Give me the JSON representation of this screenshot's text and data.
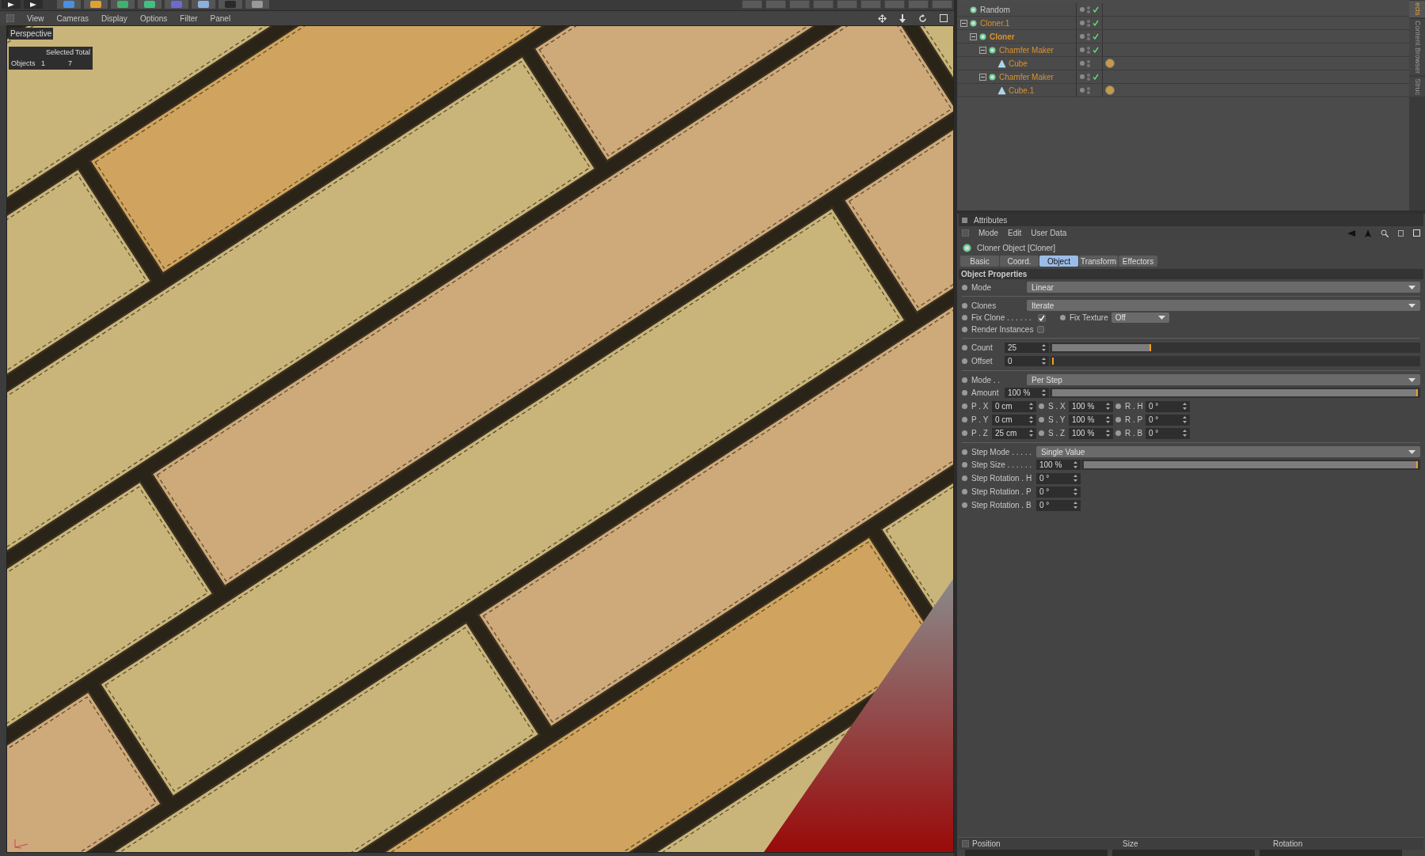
{
  "viewport": {
    "menu": [
      "View",
      "Cameras",
      "Display",
      "Options",
      "Filter",
      "Panel"
    ],
    "camera": "Perspective",
    "hud": {
      "headers": [
        "Selected",
        "Total"
      ],
      "row": {
        "label": "Objects",
        "selected": "1",
        "total": "7"
      }
    }
  },
  "object_manager": {
    "objects": [
      {
        "name": "Random",
        "active": false,
        "selected": false,
        "checked": true,
        "material": false
      },
      {
        "name": "Cloner.1",
        "active": true,
        "selected": false,
        "checked": true,
        "material": false,
        "expanded": true,
        "children": [
          {
            "name": "Cloner",
            "active": true,
            "selected": true,
            "checked": true,
            "material": false,
            "expanded": true,
            "children": [
              {
                "name": "Chamfer Maker",
                "active": true,
                "selected": false,
                "checked": true,
                "material": false,
                "expanded": true,
                "children": [
                  {
                    "name": "Cube",
                    "active": true,
                    "selected": false,
                    "checked": false,
                    "material": true
                  }
                ]
              },
              {
                "name": "Chamfer Maker",
                "active": true,
                "selected": false,
                "checked": true,
                "material": false,
                "expanded": true,
                "children": [
                  {
                    "name": "Cube.1",
                    "active": true,
                    "selected": false,
                    "checked": false,
                    "material": true
                  }
                ]
              }
            ]
          }
        ]
      }
    ],
    "side_tabs": [
      {
        "label": "ects",
        "selected": true
      },
      {
        "label": "Content Browser",
        "selected": false
      },
      {
        "label": "Struc",
        "selected": false
      }
    ]
  },
  "attributes": {
    "title": "Attributes",
    "menu": [
      "Mode",
      "Edit",
      "User Data"
    ],
    "object_title": "Cloner Object [Cloner]",
    "tabs": [
      {
        "label": "Basic",
        "selected": false
      },
      {
        "label": "Coord.",
        "selected": false
      },
      {
        "label": "Object",
        "selected": true
      },
      {
        "label": "Transform",
        "selected": false
      },
      {
        "label": "Effectors",
        "selected": false
      }
    ],
    "section": "Object Properties",
    "rows": [
      {
        "kind": "dropdown",
        "label": "Mode",
        "value": "Linear",
        "divider_before": false
      },
      {
        "kind": "dropdown",
        "label": "Clones",
        "value": "Iterate",
        "divider_before": true
      },
      {
        "kind": "check_combo",
        "label": "Fix Clone . . . . . .",
        "checked": true,
        "second_label": "Fix Texture",
        "value": "Off",
        "divider_before": false
      },
      {
        "kind": "checkbox",
        "label": "Render Instances",
        "checked": false,
        "divider_before": false
      },
      {
        "kind": "slider",
        "label": "Count",
        "value": "25",
        "level": 0.27,
        "divider_before": true
      },
      {
        "kind": "slider",
        "label": "Offset",
        "value": "0",
        "level": 0,
        "divider_before": false
      },
      {
        "kind": "dropdown",
        "label": "Mode . .",
        "value": "Per Step",
        "divider_before": true
      },
      {
        "kind": "slider",
        "label": "Amount",
        "value": "100 %",
        "level": 1,
        "divider_before": false
      },
      {
        "kind": "vector",
        "cells": [
          {
            "label": "P . X",
            "value": "0 cm"
          },
          {
            "label": "S . X",
            "value": "100 %"
          },
          {
            "label": "R . H",
            "value": "0 °"
          }
        ],
        "divider_before": false
      },
      {
        "kind": "vector",
        "cells": [
          {
            "label": "P . Y",
            "value": "0 cm"
          },
          {
            "label": "S . Y",
            "value": "100 %"
          },
          {
            "label": "R . P",
            "value": "0 °"
          }
        ],
        "divider_before": false
      },
      {
        "kind": "vector",
        "cells": [
          {
            "label": "P . Z",
            "value": "25 cm"
          },
          {
            "label": "S . Z",
            "value": "100 %"
          },
          {
            "label": "R . B",
            "value": "0 °"
          }
        ],
        "divider_before": false
      },
      {
        "kind": "dropdown",
        "label": "Step Mode . . . . .",
        "value": "Single Value",
        "divider_before": true
      },
      {
        "kind": "slider",
        "label": "Step Size . . . . . .",
        "value": "100 %",
        "level": 1,
        "divider_before": false
      },
      {
        "kind": "number",
        "label": "Step Rotation . H",
        "value": "0 °",
        "divider_before": false
      },
      {
        "kind": "number",
        "label": "Step Rotation . P",
        "value": "0 °",
        "divider_before": false
      },
      {
        "kind": "number",
        "label": "Step Rotation . B",
        "value": "0 °",
        "divider_before": false
      }
    ]
  },
  "coordinates": {
    "headers": [
      "Position",
      "Size",
      "Rotation"
    ]
  }
}
